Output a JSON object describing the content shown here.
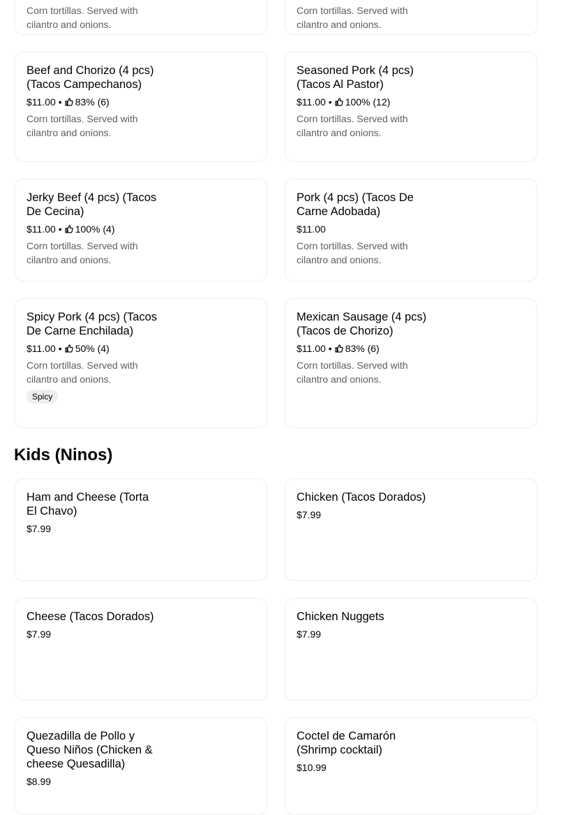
{
  "top_cards": [
    {
      "desc": "Corn tortillas. Served with cilantro and onions."
    },
    {
      "desc": "Corn tortillas. Served with cilantro and onions."
    }
  ],
  "tacos": [
    {
      "name": "Beef and Chorizo (4 pcs) (Tacos Campechanos)",
      "price": "$11.00",
      "rating": "83% (6)",
      "desc": "Corn tortillas. Served with cilantro and onions."
    },
    {
      "name": "Seasoned Pork (4 pcs) (Tacos Al Pastor)",
      "price": "$11.00",
      "rating": "100% (12)",
      "desc": "Corn tortillas. Served with cilantro and onions."
    },
    {
      "name": "Jerky Beef (4 pcs) (Tacos De Cecina)",
      "price": "$11.00",
      "rating": "100% (4)",
      "desc": "Corn tortillas. Served with cilantro and onions."
    },
    {
      "name": "Pork (4 pcs) (Tacos De Carne Adobada)",
      "price": "$11.00",
      "desc": "Corn tortillas. Served with cilantro and onions."
    },
    {
      "name": "Spicy Pork (4 pcs) (Tacos De Carne Enchilada)",
      "price": "$11.00",
      "rating": "50% (4)",
      "desc": "Corn tortillas. Served with cilantro and onions.",
      "tag": "Spicy"
    },
    {
      "name": "Mexican Sausage (4 pcs) (Tacos de Chorizo)",
      "price": "$11.00",
      "rating": "83% (6)",
      "desc": "Corn tortillas. Served with cilantro and onions."
    }
  ],
  "rating_separator": "•",
  "kids": {
    "title": "Kids (Ninos)",
    "items": [
      {
        "name": "Ham and Cheese (Torta El Chavo)",
        "price": "$7.99"
      },
      {
        "name": "Chicken (Tacos Dorados)",
        "price": "$7.99"
      },
      {
        "name": "Cheese (Tacos Dorados)",
        "price": "$7.99"
      },
      {
        "name": "Chicken Nuggets",
        "price": "$7.99"
      },
      {
        "name": "Quezadilla de Pollo y Queso Niños (Chicken & cheese Quesadilla)",
        "price": "$8.99"
      },
      {
        "name": "Coctel de Camarón (Shrimp cocktail)",
        "price": "$10.99"
      }
    ]
  },
  "icons": {
    "rating": "thumbs-up-icon"
  },
  "colors": {
    "border": "#ededed",
    "secondary_text": "#5e5e5e",
    "tag_bg": "#eeeeee"
  }
}
